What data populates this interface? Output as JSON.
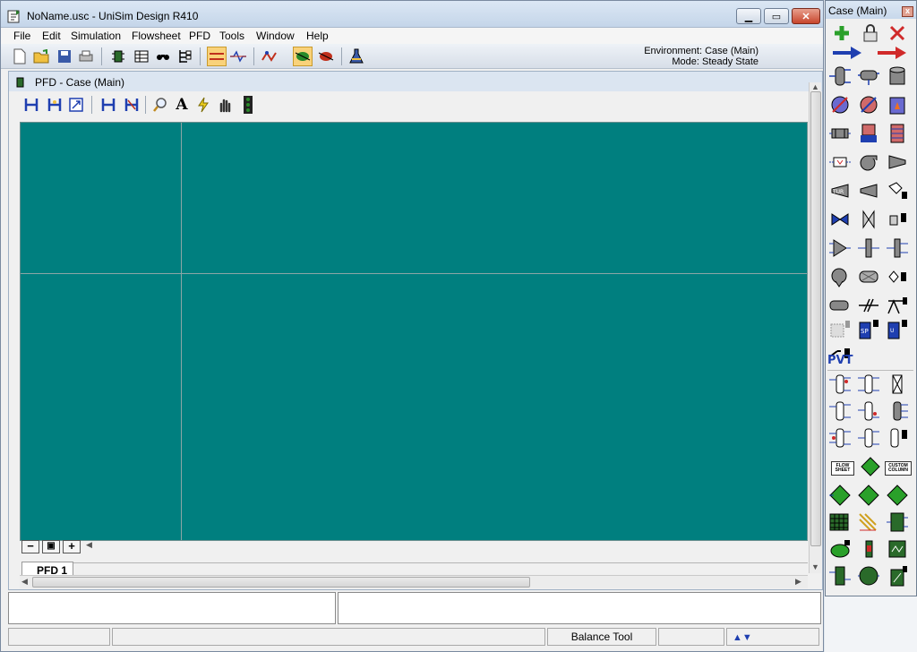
{
  "window": {
    "title": "NoName.usc - UniSim Design R410"
  },
  "menu": {
    "items": [
      "File",
      "Edit",
      "Simulation",
      "Flowsheet",
      "PFD",
      "Tools",
      "Window",
      "Help"
    ]
  },
  "toolbar": {
    "icons": [
      "new-file-icon",
      "open-file-icon",
      "save-icon",
      "print-icon",
      "simulation-navigator-icon",
      "workbook-icon",
      "object-navigator-icon",
      "object-tree-icon",
      "steady-state-icon",
      "dynamics-icon",
      "integrator-icon",
      "solver-active-icon",
      "solver-holding-icon",
      "flask-icon"
    ]
  },
  "environment": {
    "environment_label": "Environment: Case (Main)",
    "mode_label": "Mode: Steady State"
  },
  "pfd": {
    "title": "PFD - Case (Main)",
    "tab_label": "PFD 1",
    "tools": [
      "auto-position-icon",
      "attach-mode-icon",
      "zoom-fit-icon",
      "break-connection-icon",
      "hide-icon",
      "zoom-icon",
      "text-icon",
      "shortcut-icon",
      "pan-icon",
      "color-scheme-icon"
    ],
    "canvas_color": "#007f7f",
    "zoom_out": "−",
    "zoom_fit": "▣",
    "zoom_in": "+"
  },
  "status_bar": {
    "balance_tool_label": "Balance Tool"
  },
  "palette": {
    "title": "Case (Main)",
    "close": "x",
    "pvt_label": "PVT",
    "flowsheet_btn": "FLOW SHEET",
    "custom_column_btn": "CUSTOM COLUMN"
  }
}
